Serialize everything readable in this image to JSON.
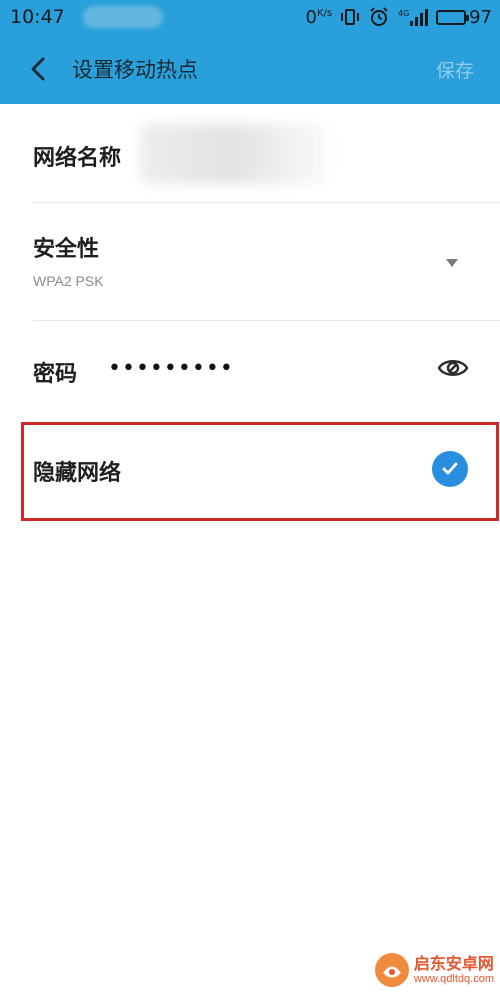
{
  "status_bar": {
    "time": "10:47",
    "speed": "0",
    "speed_unit": "K/s",
    "battery": "97",
    "battery_level": 0.97,
    "background": "#29a0db"
  },
  "app_bar": {
    "back_icon": "chevron-left-icon",
    "title": "设置移动热点",
    "save_label": "保存",
    "background": "#29a0db"
  },
  "form": {
    "network_name_label": "网络名称",
    "security_label": "安全性",
    "security_value": "WPA2 PSK",
    "password_label": "密码",
    "password_value": "•••••••••",
    "password_toggle_icon": "eye-icon",
    "hide_network_label": "隐藏网络",
    "hide_network_checked": true,
    "check_color": "#2a8ee0"
  },
  "annotation": {
    "highlight_color": "#d3262b"
  },
  "watermark": {
    "title": "启东安卓网",
    "url": "www.qdltdq.com"
  }
}
